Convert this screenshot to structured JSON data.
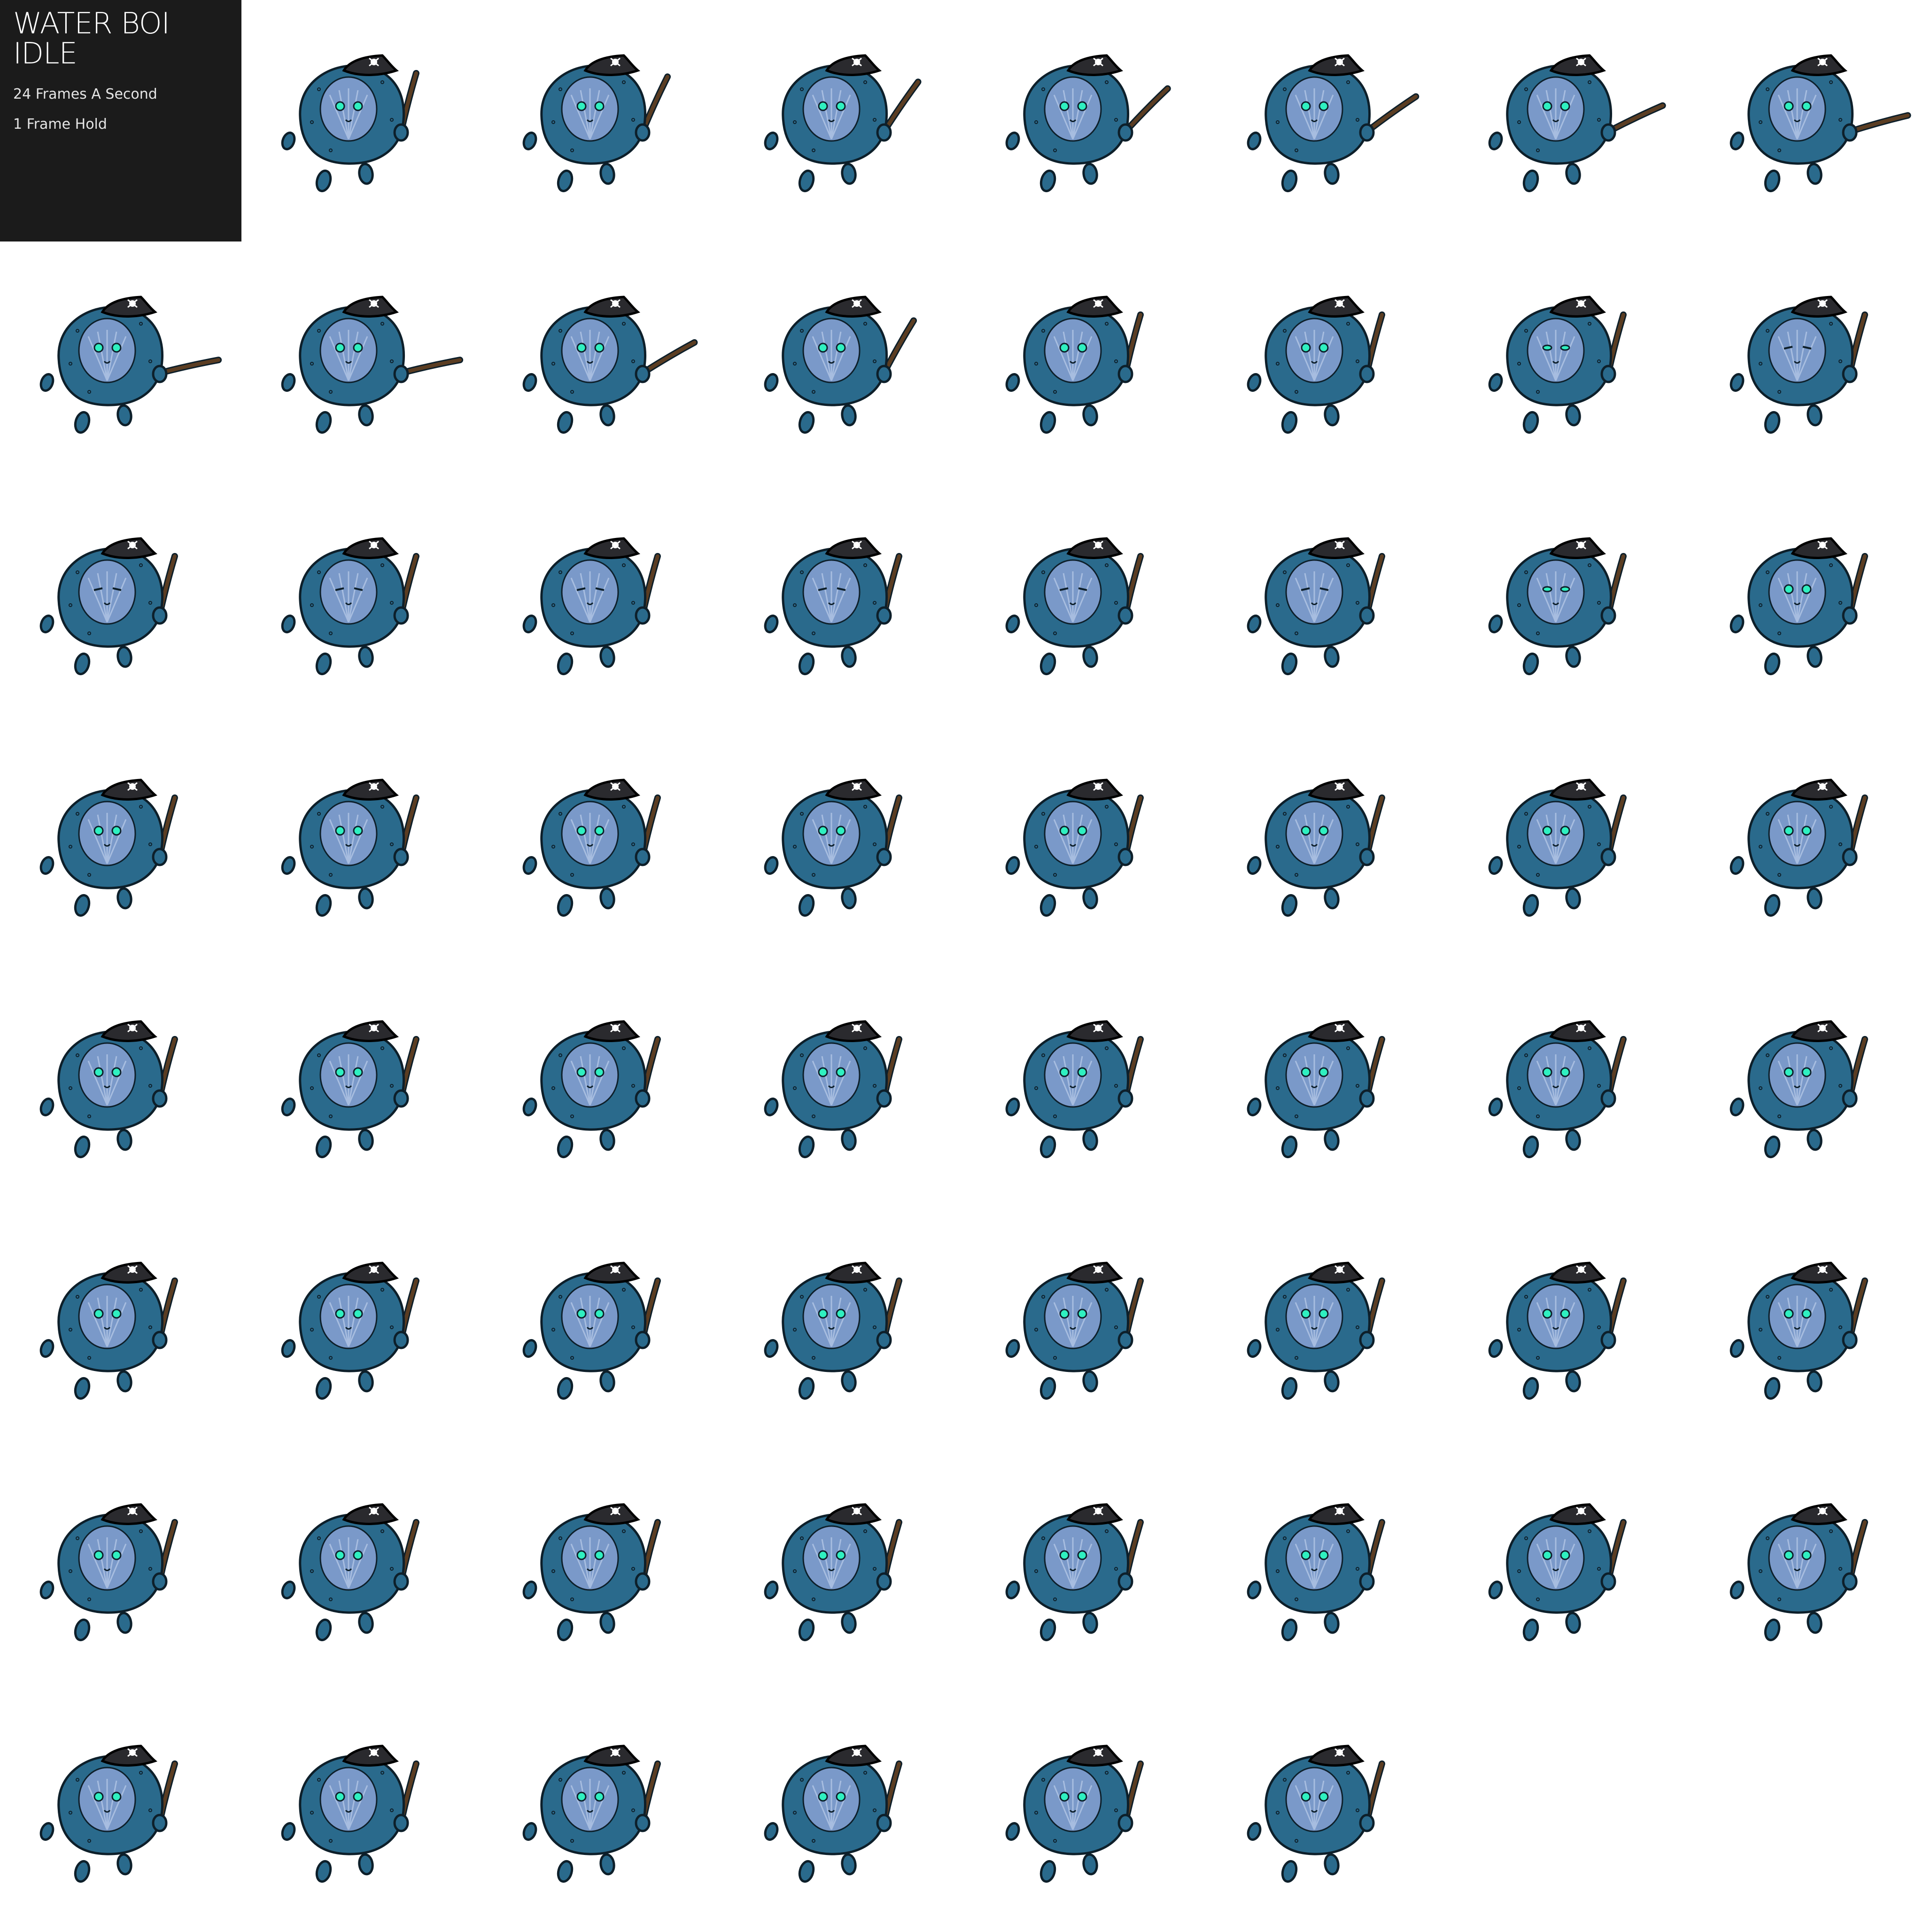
{
  "sheet": {
    "title_line1": "WATER BOI",
    "title_line2": "IDLE",
    "fps_label": "24 Frames A Second",
    "hold_label": "1 Frame Hold"
  },
  "animation": {
    "frame_count": 61,
    "columns": 8,
    "info_panel_cell": 0,
    "sword_angles_deg": [
      -55,
      -45,
      -35,
      -25,
      -15,
      -5,
      5,
      8,
      8,
      -10,
      -40,
      -55,
      -55,
      -55,
      -55,
      -55,
      -55,
      -55,
      -55,
      -55,
      -55,
      -55,
      -55,
      -55,
      -55,
      -55,
      -55,
      -55,
      -55,
      -55,
      -55,
      -55,
      -55,
      -55,
      -55,
      -55,
      -55,
      -55,
      -55,
      -55,
      -55,
      -55,
      -55,
      -55,
      -55,
      -55,
      -55,
      -55,
      -55,
      -55,
      -55,
      -55,
      -55,
      -55,
      -55,
      -55,
      -55,
      -55,
      -55,
      -55,
      -55
    ],
    "eye_state": [
      "open",
      "open",
      "open",
      "open",
      "open",
      "open",
      "open",
      "open",
      "open",
      "open",
      "open",
      "open",
      "open",
      "half",
      "closed",
      "closed",
      "closed",
      "closed",
      "closed",
      "closed",
      "closed",
      "half",
      "open",
      "open",
      "open",
      "open",
      "open",
      "open",
      "open",
      "open",
      "open",
      "open",
      "open",
      "open",
      "open",
      "open",
      "open",
      "open",
      "open",
      "open",
      "open",
      "open",
      "open",
      "open",
      "open",
      "open",
      "open",
      "open",
      "open",
      "open",
      "open",
      "open",
      "open",
      "open",
      "open",
      "open",
      "open",
      "open",
      "open",
      "open",
      "open"
    ]
  },
  "colors": {
    "panel_bg": "#1b1b1b",
    "body": "#2a6a8c",
    "body_outline": "#0d1f2a",
    "face": "#7a99c9",
    "face_light": "#a7bde0",
    "eye": "#2ff0c0",
    "hat": "#2a2a2e",
    "sword": "#5b3d22",
    "feet": "#2a6a8c"
  },
  "icons": {
    "character": "water-boi-pirate-sprite",
    "hat_emblem": "skull-and-crossbones-icon"
  }
}
